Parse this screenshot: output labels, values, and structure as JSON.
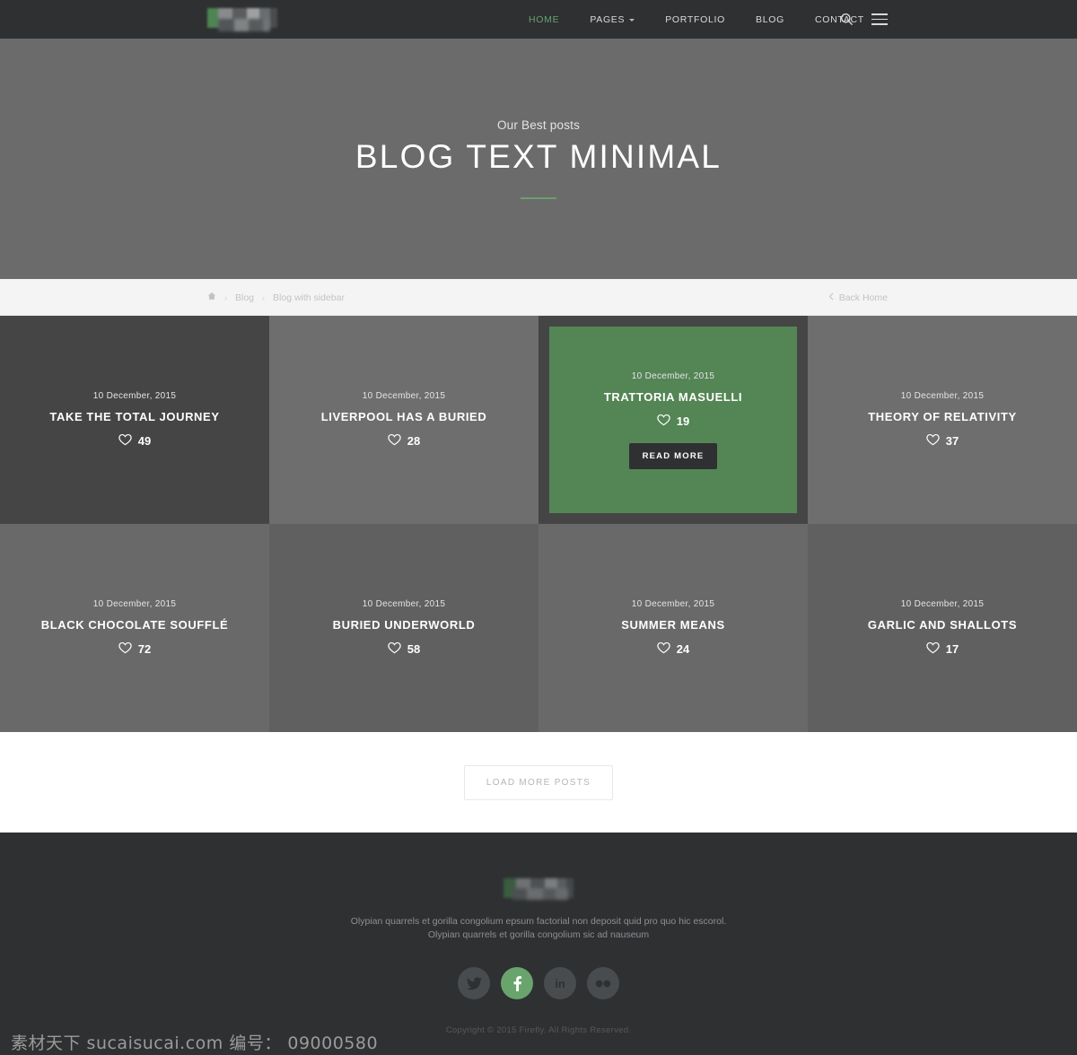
{
  "header": {
    "logo_name": "firefly-logo",
    "nav": [
      {
        "label": "HOME",
        "active": true,
        "caret": false
      },
      {
        "label": "PAGES",
        "active": false,
        "caret": true
      },
      {
        "label": "PORTFOLIO",
        "active": false,
        "caret": false
      },
      {
        "label": "BLOG",
        "active": false,
        "caret": false
      },
      {
        "label": "CONTACT",
        "active": false,
        "caret": false
      }
    ],
    "search_icon": "search-icon",
    "menu_icon": "hamburger-menu-icon"
  },
  "hero": {
    "subtitle": "Our Best posts",
    "title": "BLOG TEXT MINIMAL",
    "accent_color": "#6aa06f",
    "background_color": "#6b6b6b"
  },
  "breadcrumb": {
    "home_icon": "home-icon",
    "items": [
      "Blog",
      "Blog with sidebar"
    ],
    "separator": "›",
    "back_label": "Back Home",
    "back_icon": "chevron-left-icon"
  },
  "posts": [
    {
      "date": "10 December, 2015",
      "title": "TAKE THE TOTAL JOURNEY",
      "likes": "49",
      "shade": "dark",
      "hover": false
    },
    {
      "date": "10 December, 2015",
      "title": "LIVERPOOL HAS A BURIED",
      "likes": "28",
      "shade": "gray",
      "hover": false
    },
    {
      "date": "10 December, 2015",
      "title": "TRATTORIA MASUELLI",
      "likes": "19",
      "shade": "dark",
      "hover": true
    },
    {
      "date": "10 December, 2015",
      "title": "THEORY OF RELATIVITY",
      "likes": "37",
      "shade": "gray",
      "hover": false
    },
    {
      "date": "10 December, 2015",
      "title": "BLACK CHOCOLATE SOUFFLÉ",
      "likes": "72",
      "shade": "light",
      "hover": false
    },
    {
      "date": "10 December, 2015",
      "title": "BURIED UNDERWORLD",
      "likes": "58",
      "shade": "mid",
      "hover": false
    },
    {
      "date": "10 December, 2015",
      "title": "SUMMER MEANS",
      "likes": "24",
      "shade": "light",
      "hover": false
    },
    {
      "date": "10 December, 2015",
      "title": "GARLIC AND SHALLOTS",
      "likes": "17",
      "shade": "mid",
      "hover": false
    }
  ],
  "hover_card": {
    "read_more_label": "READ MORE",
    "background_color": "#548555"
  },
  "load_more": {
    "label": "LOAD MORE POSTS"
  },
  "footer": {
    "logo_name": "firefly-footer-logo",
    "line1": "Olypian quarrels et gorilla congolium epsum factorial non deposit quid pro quo hic escorol.",
    "line2": "Olypian quarrels et gorilla congolium sic ad nauseum",
    "socials": [
      {
        "name": "twitter-icon",
        "active": false
      },
      {
        "name": "facebook-icon",
        "active": true
      },
      {
        "name": "linkedin-icon",
        "active": false
      },
      {
        "name": "flickr-icon",
        "active": false
      }
    ],
    "copyright": "Copyright © 2015 Firefly. All Rights Reserved."
  },
  "watermark": "素材天下 sucaisucai.com  编号： 09000580"
}
